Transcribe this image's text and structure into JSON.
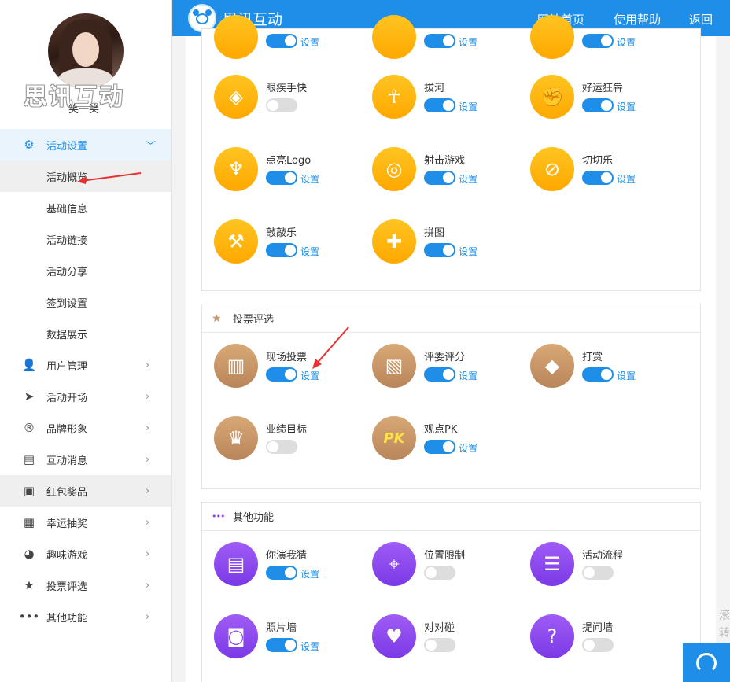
{
  "brand": {
    "name": "思讯互动"
  },
  "topnav": {
    "home": "网站首页",
    "help": "使用帮助",
    "back": "返回"
  },
  "profile": {
    "watermark": "思讯互动",
    "username": "笑一笑"
  },
  "sidebar": {
    "active_group": {
      "label": "活动设置",
      "icon": "gear-icon"
    },
    "sub_items": [
      "活动概览",
      "基础信息",
      "活动链接",
      "活动分享",
      "签到设置",
      "数据展示"
    ],
    "groups": [
      {
        "label": "用户管理",
        "icon": "user-icon"
      },
      {
        "label": "活动开场",
        "icon": "paper-plane-icon"
      },
      {
        "label": "品牌形象",
        "icon": "registered-icon"
      },
      {
        "label": "互动消息",
        "icon": "chat-icon"
      },
      {
        "label": "红包奖品",
        "icon": "gift-box-icon"
      },
      {
        "label": "幸运抽奖",
        "icon": "lottery-icon"
      },
      {
        "label": "趣味游戏",
        "icon": "game-icon"
      },
      {
        "label": "投票评选",
        "icon": "star-icon"
      },
      {
        "label": "其他功能",
        "icon": "more-dots-icon"
      }
    ]
  },
  "setting_label": "设置",
  "games": [
    {
      "name": "眼疾手快",
      "on": false,
      "icon": "eye-icon"
    },
    {
      "name": "拔河",
      "on": true,
      "icon": "tug-of-war-icon"
    },
    {
      "name": "好运狂犇",
      "on": true,
      "icon": "fist-icon"
    },
    {
      "name": "点亮Logo",
      "on": true,
      "icon": "torch-icon"
    },
    {
      "name": "射击游戏",
      "on": true,
      "icon": "target-icon"
    },
    {
      "name": "切切乐",
      "on": true,
      "icon": "slice-icon"
    },
    {
      "name": "敲敲乐",
      "on": true,
      "icon": "hammer-icon"
    },
    {
      "name": "拼图",
      "on": true,
      "icon": "puzzle-icon"
    }
  ],
  "vote_section": {
    "title": "投票评选",
    "items": [
      {
        "name": "现场投票",
        "on": true,
        "icon": "bar-chart-icon"
      },
      {
        "name": "评委评分",
        "on": true,
        "icon": "scorecard-icon"
      },
      {
        "name": "打赏",
        "on": true,
        "icon": "diamond-icon"
      },
      {
        "name": "业绩目标",
        "on": false,
        "icon": "trophy-icon"
      },
      {
        "name": "观点PK",
        "on": true,
        "icon": "pk-icon"
      }
    ]
  },
  "other_section": {
    "title": "其他功能",
    "items": [
      {
        "name": "你演我猜",
        "on": true,
        "icon": "clapperboard-icon"
      },
      {
        "name": "位置限制",
        "on": false,
        "icon": "location-pin-icon"
      },
      {
        "name": "活动流程",
        "on": false,
        "icon": "layers-icon"
      },
      {
        "name": "照片墙",
        "on": true,
        "icon": "camera-icon"
      },
      {
        "name": "对对碰",
        "on": false,
        "icon": "hearts-icon"
      },
      {
        "name": "提问墙",
        "on": false,
        "icon": "question-board-icon"
      }
    ]
  },
  "side_text": "滚转",
  "colors": {
    "primary": "#1e8ee8",
    "yellow": "#ffb400",
    "brown": "#c8966a",
    "purple": "#8b45ee"
  }
}
